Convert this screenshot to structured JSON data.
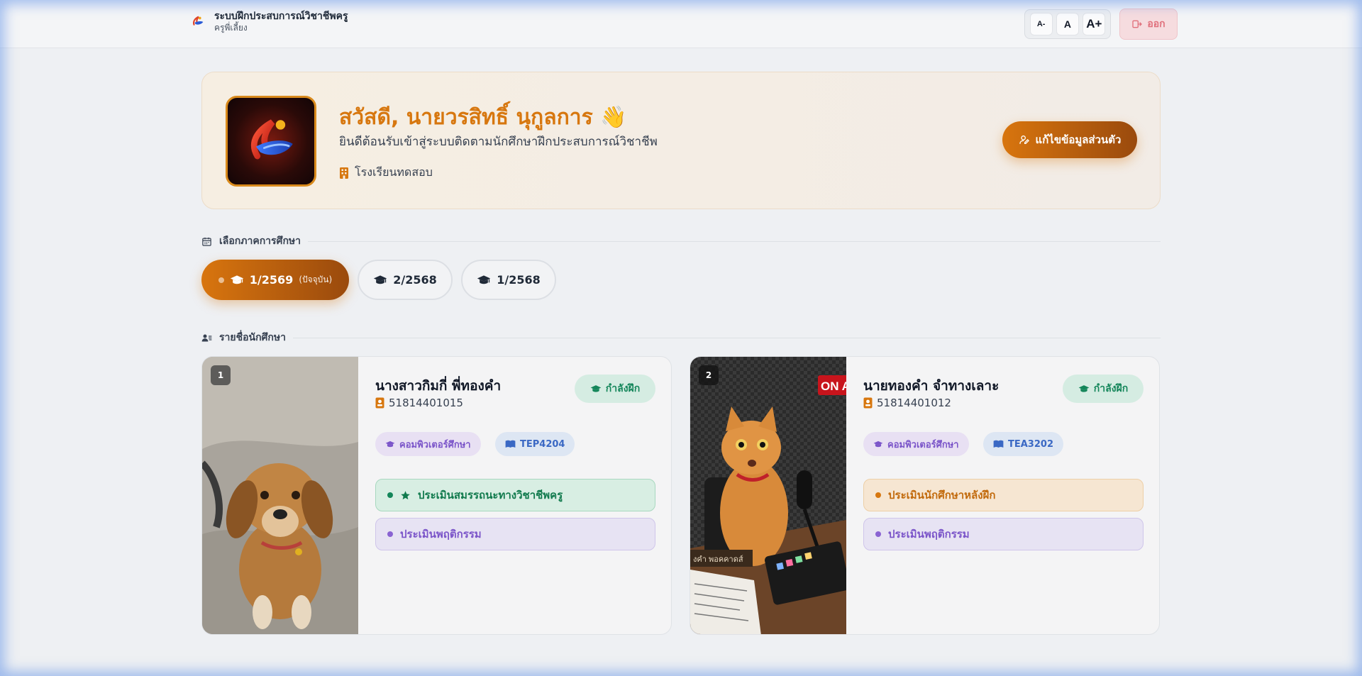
{
  "header": {
    "title": "ระบบฝึกประสบการณ์วิชาชีพครู",
    "subtitle": "ครูพี่เลี้ยง",
    "font_small": "A-",
    "font_normal": "A",
    "font_large": "A+",
    "logout_label": "ออก"
  },
  "welcome": {
    "greeting": "สวัสดี, นายวรสิทธิ์ นุกูลการ 👋",
    "subtitle": "ยินดีต้อนรับเข้าสู่ระบบติดตามนักศึกษาฝึกประสบการณ์วิชาชีพ",
    "school": "โรงเรียนทดสอบ",
    "edit_label": "แก้ไขข้อมูลส่วนตัว"
  },
  "semester_section": {
    "title": "เลือกภาคการศึกษา",
    "pills": [
      {
        "label": "1/2569",
        "tag": "(ปัจจุบัน)"
      },
      {
        "label": "2/2568"
      },
      {
        "label": "1/2568"
      }
    ]
  },
  "students_section": {
    "title": "รายชื่อนักศึกษา",
    "students": [
      {
        "number": "1",
        "name": "นางสาวกิมกี่ พี่ทองคำ",
        "id": "51814401015",
        "status": "กำลังฝึก",
        "major": "คอมพิวเตอร์ศึกษา",
        "course": "TEP4204",
        "eval_primary": "ประเมินสมรรถนะทางวิชาชีพครู",
        "eval_secondary": "ประเมินพฤติกรรม"
      },
      {
        "number": "2",
        "name": "นายทองคำ จำทางเลาะ",
        "id": "51814401012",
        "status": "กำลังฝึก",
        "major": "คอมพิวเตอร์ศึกษา",
        "course": "TEA3202",
        "eval_primary": "ประเมินนักศึกษาหลังฝึก",
        "eval_secondary": "ประเมินพฤติกรรม"
      }
    ],
    "photo_sign_text": "ON A",
    "photo_plate_text": "งคำ พอคคาดส์"
  },
  "colors": {
    "accent": "#d7770f",
    "accent_dark": "#9a4a0d",
    "success": "#14865a",
    "purple": "#7b55c9",
    "blue": "#3a68c4",
    "danger": "#e0707c"
  }
}
